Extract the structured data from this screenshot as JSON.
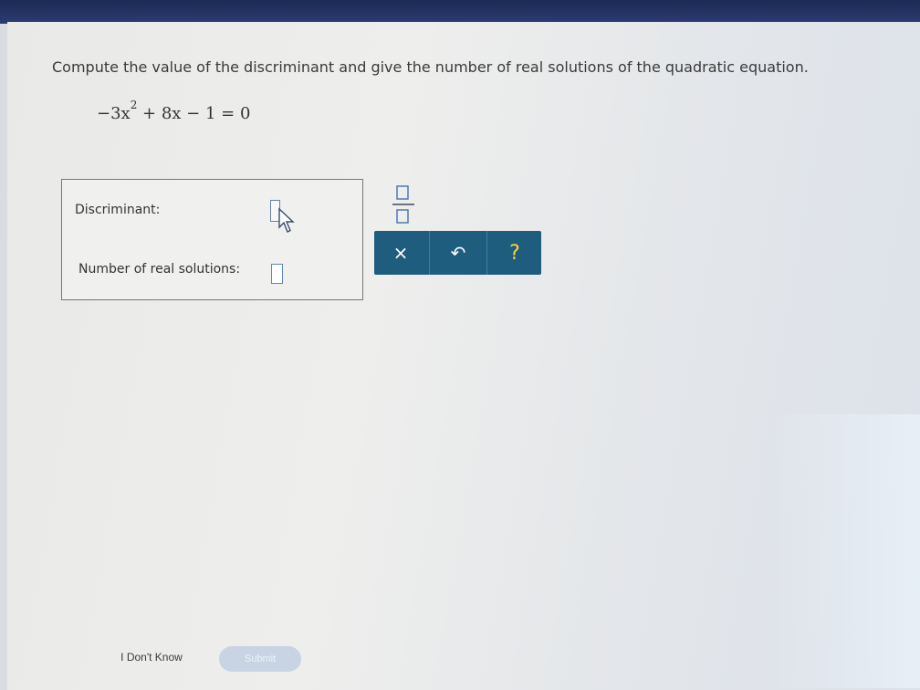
{
  "question": {
    "prompt": "Compute the value of the discriminant and give the number of real solutions of the quadratic equation."
  },
  "equation": {
    "lead": "−3x",
    "exponent": "2",
    "rest": " + 8x − 1 = 0"
  },
  "answers": {
    "discriminant_label": "Discriminant:",
    "discriminant_value": "",
    "solutions_label": "Number of real solutions:",
    "solutions_value": ""
  },
  "toolbar": {
    "clear_symbol": "×",
    "undo_symbol": "↶",
    "help_symbol": "?"
  },
  "footer": {
    "dont_know_label": "I Don't Know",
    "submit_label": "Submit"
  },
  "icons": {
    "fraction": "fraction-icon",
    "cursor": "mouse-cursor-icon"
  },
  "colors": {
    "toolbar": "#1f5d7e",
    "help": "#ffd43a",
    "submit_disabled": "#c8d4e4"
  }
}
